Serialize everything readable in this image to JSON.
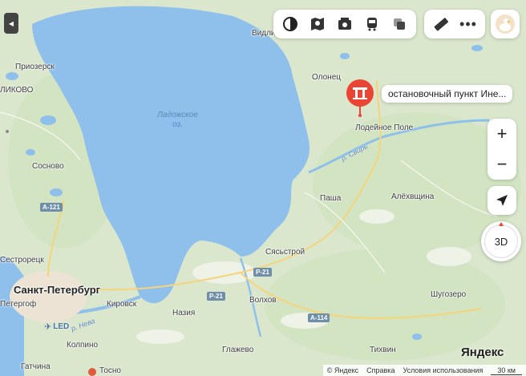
{
  "map": {
    "lake_name": "Ладожское\nоз.",
    "river_name_1": "р. Свирь",
    "river_name_2": "р. Нева",
    "places": {
      "vidlitsa": "Видлица",
      "priozersk": "Приозерск",
      "olonets": "Олонец",
      "lodeynoe_pole": "Лодейное Поле",
      "sosnovo": "Сосново",
      "pasha": "Паша",
      "alekhovshchina": "Алёхвщина",
      "sestroretsk": "Сестрорецк",
      "spb": "Санкт-Петербург",
      "syasstroy": "Сясьстрой",
      "peterhof": "Петергоф",
      "kirovsk": "Кировск",
      "nazia": "Назия",
      "volkhov": "Волхов",
      "shugozero": "Шугозеро",
      "kolpino": "Колпино",
      "glazhevo": "Глажево",
      "tikhvin": "Тихвин",
      "gatchina": "Гатчина",
      "tosno": "Тосно",
      "kiikovo": "ЛИКОВО"
    },
    "roads": {
      "a121": "А-121",
      "r21a": "Р-21",
      "r21b": "Р-21",
      "a114": "А-114"
    },
    "airport": "LED"
  },
  "pin": {
    "label": "остановочный пункт Ине..."
  },
  "toolbar": {
    "items": [
      "layers-icon",
      "map-book-icon",
      "panorama-icon",
      "transit-icon",
      "stack-icon"
    ],
    "ruler": "ruler-icon",
    "more": "more-icon"
  },
  "controls": {
    "zoom_in": "+",
    "zoom_out": "−",
    "view_3d": "3D"
  },
  "branding": {
    "logo": "Яндекс"
  },
  "footer": {
    "copyright": "© Яндекс",
    "help": "Справка",
    "terms": "Условия использования",
    "scale": "30 км"
  },
  "colors": {
    "water": "#8fc0ec",
    "land": "#dfe9d3",
    "forest": "#cfe0bf",
    "pin": "#e94434",
    "city": "#f0e6d8"
  }
}
